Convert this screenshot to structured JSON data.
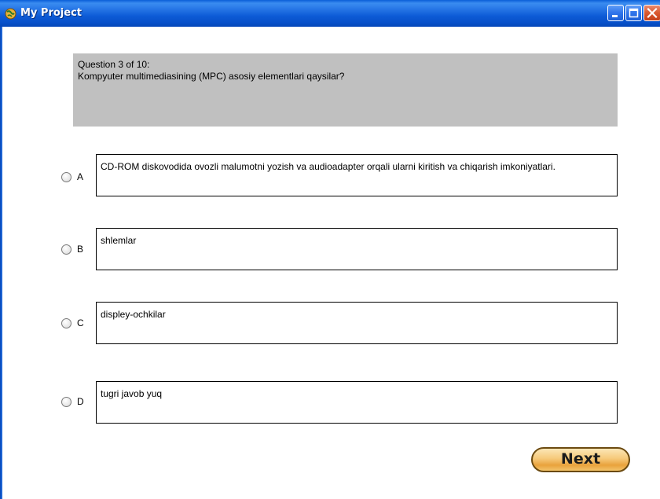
{
  "window": {
    "title": "My Project",
    "icon": "app-globe-icon"
  },
  "question": {
    "counter": "Question 3 of 10:",
    "text": "Kompyuter multimediasining (MPC) asosiy elementlari qaysilar?"
  },
  "answers": [
    {
      "letter": "A",
      "text": "CD-ROM diskovodida ovozli malumotni yozish va audioadapter orqali ularni kiritish va chiqarish imkoniyatlari."
    },
    {
      "letter": "B",
      "text": "shlemlar"
    },
    {
      "letter": "C",
      "text": "displey-ochkilar"
    },
    {
      "letter": "D",
      "text": "tugri javob yuq"
    }
  ],
  "actions": {
    "next_label": "Next"
  },
  "colors": {
    "titlebar": "#0750c9",
    "question_bg": "#c0c0c0",
    "next_button": "#f6c97a"
  }
}
